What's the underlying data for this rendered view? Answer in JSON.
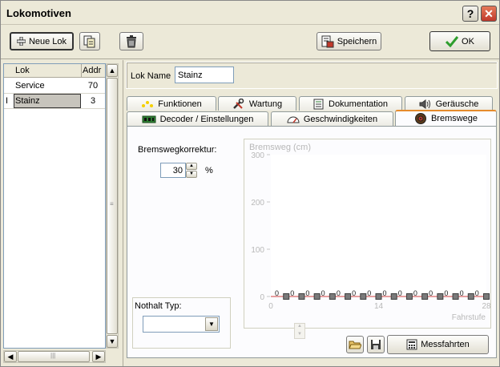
{
  "window": {
    "title": "Lokomotiven",
    "help_label": "?",
    "close_label": "✕"
  },
  "toolbar": {
    "new_lok_label": "Neue Lok",
    "save_label": "Speichern",
    "ok_label": "OK"
  },
  "list": {
    "headers": {
      "lok": "Lok",
      "addr": "Addr"
    },
    "rows": [
      {
        "name": "Service",
        "addr": "70"
      },
      {
        "name": "Stainz",
        "addr": "3"
      }
    ],
    "cursor_mark": "I"
  },
  "form": {
    "lok_name_label": "Lok Name",
    "lok_name_value": "Stainz"
  },
  "tabs": {
    "row1": [
      "Funktionen",
      "Wartung",
      "Dokumentation",
      "Geräusche"
    ],
    "row2": [
      "Decoder / Einstellungen",
      "Geschwindigkeiten",
      "Bremswege"
    ]
  },
  "bremswege": {
    "korrektur_label": "Bremswegkorrektur:",
    "korrektur_value": "30",
    "korrektur_unit": "%",
    "nothalt_label": "Nothalt Typ:",
    "nothalt_value": "",
    "messfahrten_label": "Messfahrten"
  },
  "chart_data": {
    "type": "line",
    "title": "Bremsweg (cm)",
    "xlabel": "Fahrstufe",
    "ylabel": "",
    "xlim": [
      0,
      28
    ],
    "ylim": [
      0,
      300
    ],
    "y_ticks": [
      "0",
      "100",
      "200",
      "300"
    ],
    "x_ticks": [
      "0",
      "14",
      "28"
    ],
    "series": [
      {
        "x": [
          0,
          2,
          4,
          6,
          8,
          10,
          12,
          14,
          16,
          18,
          20,
          22,
          24,
          26,
          28
        ],
        "values": [
          0,
          0,
          0,
          0,
          0,
          0,
          0,
          0,
          0,
          0,
          0,
          0,
          0,
          0,
          0
        ]
      }
    ],
    "point_labels": [
      "0",
      "0",
      "0",
      "0",
      "0",
      "0",
      "0",
      "0",
      "0",
      "0",
      "0",
      "0",
      "0",
      "0",
      "0"
    ]
  },
  "colors": {
    "accent": "#e68b2c",
    "ok_check": "#2e9e2e",
    "window_bg": "#ece9d8"
  }
}
